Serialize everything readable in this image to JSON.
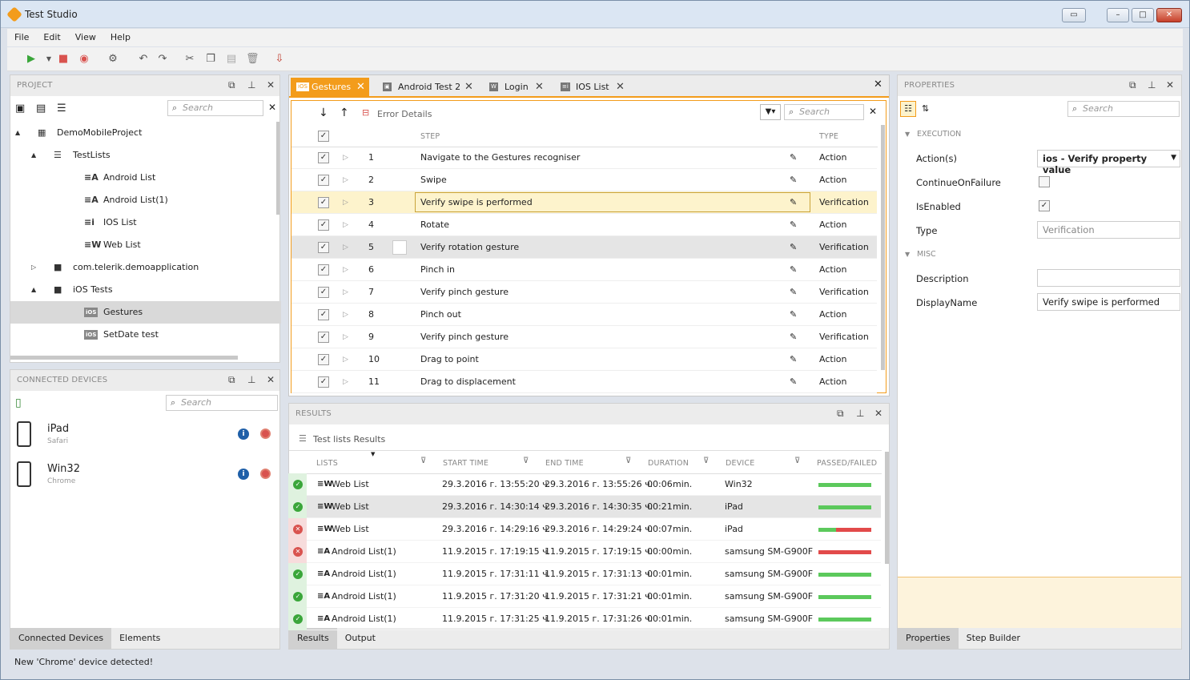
{
  "app": {
    "title": "Test Studio"
  },
  "menu": [
    "File",
    "Edit",
    "View",
    "Help"
  ],
  "project": {
    "header": "PROJECT",
    "search_placeholder": "Search",
    "tree": [
      {
        "label": "DemoMobileProject",
        "icon": "project-icon"
      },
      {
        "label": "TestLists",
        "icon": "list-icon"
      },
      {
        "label": "Android List",
        "icon": "android-list-icon",
        "glyph": "≡A"
      },
      {
        "label": "Android List(1)",
        "icon": "android-list-icon",
        "glyph": "≡A"
      },
      {
        "label": "IOS List",
        "icon": "ios-list-icon",
        "glyph": "≡i"
      },
      {
        "label": "Web List",
        "icon": "web-list-icon",
        "glyph": "≡W"
      },
      {
        "label": "com.telerik.demoapplication",
        "icon": "folder-icon"
      },
      {
        "label": "iOS Tests",
        "icon": "folder-icon"
      },
      {
        "label": "Gestures",
        "icon": "ios-test-icon",
        "glyph": "iOS"
      },
      {
        "label": "SetDate test",
        "icon": "ios-test-icon",
        "glyph": "iOS"
      }
    ]
  },
  "devices": {
    "header": "CONNECTED DEVICES",
    "search_placeholder": "Search",
    "items": [
      {
        "name": "iPad",
        "browser": "Safari"
      },
      {
        "name": "Win32",
        "browser": "Chrome"
      }
    ],
    "tabs": [
      "Connected Devices",
      "Elements"
    ]
  },
  "doc_tabs": [
    {
      "label": "Gestures",
      "icon": "iOS"
    },
    {
      "label": "Android Test 2",
      "icon": "android"
    },
    {
      "label": "Login",
      "icon": "W"
    },
    {
      "label": "IOS List",
      "icon": "≡i"
    }
  ],
  "steps": {
    "error_details": "Error Details",
    "search_placeholder": "Search",
    "col_step": "STEP",
    "col_type": "TYPE",
    "rows": [
      {
        "n": "1",
        "step": "Navigate to the Gestures recogniser",
        "type": "Action"
      },
      {
        "n": "2",
        "step": "Swipe",
        "type": "Action"
      },
      {
        "n": "3",
        "step": "Verify swipe is performed",
        "type": "Verification"
      },
      {
        "n": "4",
        "step": "Rotate",
        "type": "Action"
      },
      {
        "n": "5",
        "step": "Verify rotation gesture",
        "type": "Verification"
      },
      {
        "n": "6",
        "step": "Pinch in",
        "type": "Action"
      },
      {
        "n": "7",
        "step": "Verify pinch gesture",
        "type": "Verification"
      },
      {
        "n": "8",
        "step": "Pinch out",
        "type": "Action"
      },
      {
        "n": "9",
        "step": "Verify pinch gesture",
        "type": "Verification"
      },
      {
        "n": "10",
        "step": "Drag to point",
        "type": "Action"
      },
      {
        "n": "11",
        "step": "Drag to displacement",
        "type": "Action"
      }
    ]
  },
  "results": {
    "header": "RESULTS",
    "subtitle": "Test lists Results",
    "cols": [
      "LISTS",
      "START TIME",
      "END TIME",
      "DURATION",
      "DEVICE",
      "PASSED/FAILED"
    ],
    "rows": [
      {
        "status": "pass",
        "list": "Web List",
        "glyph": "≡W",
        "start": "29.3.2016 г. 13:55:20 ч.",
        "end": "29.3.2016 г. 13:55:26 ч.",
        "dur": "00:06",
        "unit": "min.",
        "device": "Win32",
        "pass": 1.0
      },
      {
        "status": "pass",
        "list": "Web List",
        "glyph": "≡W",
        "start": "29.3.2016 г. 14:30:14 ч.",
        "end": "29.3.2016 г. 14:30:35 ч.",
        "dur": "00:21",
        "unit": "min.",
        "device": "iPad",
        "pass": 1.0
      },
      {
        "status": "fail",
        "list": "Web List",
        "glyph": "≡W",
        "start": "29.3.2016 г. 14:29:16 ч.",
        "end": "29.3.2016 г. 14:29:24 ч.",
        "dur": "00:07",
        "unit": "min.",
        "device": "iPad",
        "pass": 0.33
      },
      {
        "status": "fail",
        "list": "Android List(1)",
        "glyph": "≡A",
        "start": "11.9.2015 г. 17:19:15 ч.",
        "end": "11.9.2015 г. 17:19:15 ч.",
        "dur": "00:00",
        "unit": "min.",
        "device": "samsung SM-G900F",
        "pass": 0.0
      },
      {
        "status": "pass",
        "list": "Android List(1)",
        "glyph": "≡A",
        "start": "11.9.2015 г. 17:31:11 ч.",
        "end": "11.9.2015 г. 17:31:13 ч.",
        "dur": "00:01",
        "unit": "min.",
        "device": "samsung SM-G900F",
        "pass": 1.0
      },
      {
        "status": "pass",
        "list": "Android List(1)",
        "glyph": "≡A",
        "start": "11.9.2015 г. 17:31:20 ч.",
        "end": "11.9.2015 г. 17:31:21 ч.",
        "dur": "00:01",
        "unit": "min.",
        "device": "samsung SM-G900F",
        "pass": 1.0
      },
      {
        "status": "pass",
        "list": "Android List(1)",
        "glyph": "≡A",
        "start": "11.9.2015 г. 17:31:25 ч.",
        "end": "11.9.2015 г. 17:31:26 ч.",
        "dur": "00:01",
        "unit": "min.",
        "device": "samsung SM-G900F",
        "pass": 1.0
      }
    ],
    "tabs": [
      "Results",
      "Output"
    ]
  },
  "properties": {
    "header": "PROPERTIES",
    "search_placeholder": "Search",
    "execution": "EXECUTION",
    "misc": "MISC",
    "actions_label": "Action(s)",
    "actions_value": "ios - Verify property value",
    "continue_label": "ContinueOnFailure",
    "enabled_label": "IsEnabled",
    "type_label": "Type",
    "type_value": "Verification",
    "description_label": "Description",
    "description_value": "",
    "displayname_label": "DisplayName",
    "displayname_value": "Verify swipe is performed",
    "tabs": [
      "Properties",
      "Step Builder"
    ]
  },
  "status_bar": "New 'Chrome' device detected!",
  "colors": {
    "accent": "#f39c1b",
    "pass": "#5cc95c",
    "fail": "#e24a4a",
    "selection": "#fdf3cc"
  }
}
